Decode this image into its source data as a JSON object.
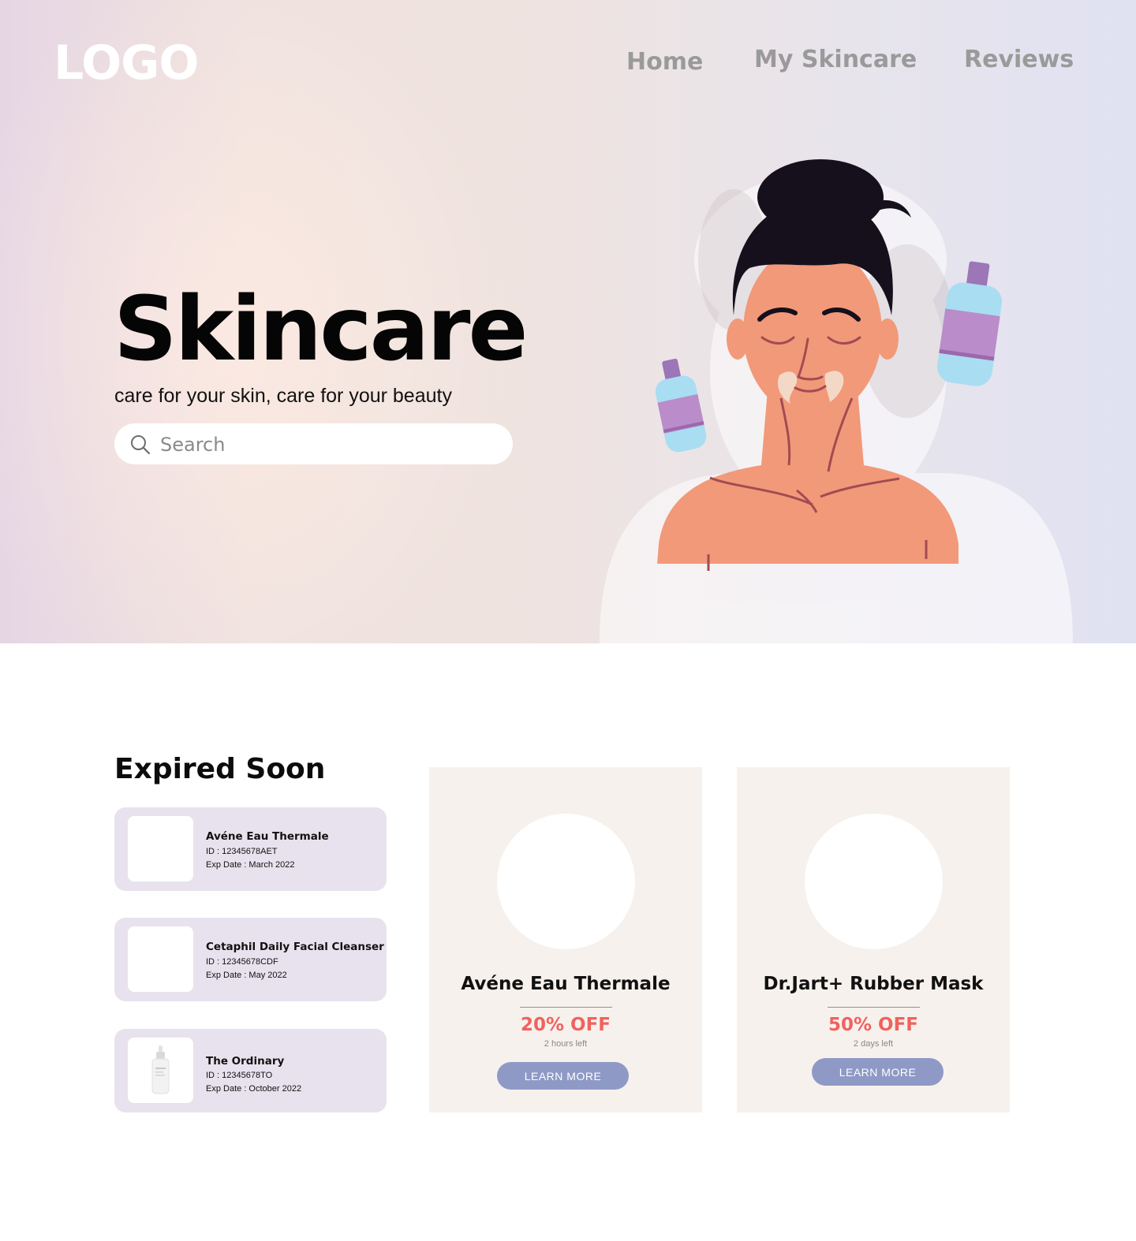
{
  "header": {
    "logo": "LOGO",
    "nav": [
      {
        "label": "Home"
      },
      {
        "label": "My Skincare"
      },
      {
        "label": "Reviews"
      }
    ]
  },
  "hero": {
    "title": "Skincare",
    "tagline": "care for your skin, care for your beauty",
    "search_placeholder": "Search",
    "search_icon": "search-icon"
  },
  "expired": {
    "title": "Expired Soon",
    "items": [
      {
        "name": "Avéne Eau Thermale",
        "id": "ID : 12345678AET",
        "exp": "Exp Date : March 2022"
      },
      {
        "name": "Cetaphil Daily Facial Cleanser",
        "id": "ID : 12345678CDF",
        "exp": "Exp Date : May 2022"
      },
      {
        "name": "The Ordinary",
        "id": "ID : 12345678TO",
        "exp": "Exp Date : October 2022"
      }
    ]
  },
  "promos": [
    {
      "name": "Avéne Eau Thermale",
      "discount": "20% OFF",
      "time_left": "2 hours left",
      "button": "LEARN MORE"
    },
    {
      "name": "Dr.Jart+ Rubber Mask",
      "discount": "50% OFF",
      "time_left": "2 days left",
      "button": "LEARN MORE"
    }
  ],
  "colors": {
    "discount": "#f0625f",
    "button": "#8f99c6",
    "expired_card": "#e8e2ee",
    "promo_card": "#f6f1ec"
  }
}
